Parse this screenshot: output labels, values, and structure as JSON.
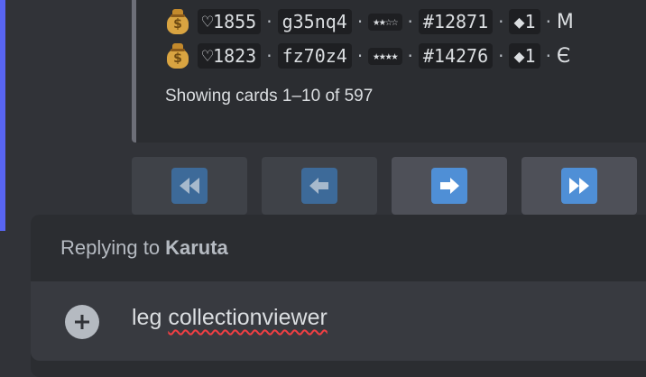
{
  "cards": [
    {
      "icon": "money-bag-icon",
      "wishlist": "♡1855",
      "code": "g35nq4",
      "stars": "★★☆☆",
      "print": "#12871",
      "edition": "◆1",
      "tail": "M"
    },
    {
      "icon": "money-bag-icon",
      "wishlist": "♡1823",
      "code": "fz70z4",
      "stars": "★★★★",
      "print": "#14276",
      "edition": "◆1",
      "tail": "Є"
    }
  ],
  "separator": "·",
  "money_symbol": "$",
  "showing_text": "Showing cards 1–10 of 597",
  "pagination": [
    {
      "name": "first-page-button",
      "icon": "double-left-arrow-icon",
      "enabled": false
    },
    {
      "name": "previous-page-button",
      "icon": "left-arrow-icon",
      "enabled": false
    },
    {
      "name": "next-page-button",
      "icon": "right-arrow-icon",
      "enabled": true
    },
    {
      "name": "last-page-button",
      "icon": "double-right-arrow-icon",
      "enabled": true
    }
  ],
  "reply": {
    "prefix": "Replying to",
    "user": "Karuta"
  },
  "composer": {
    "text_word1": "leg",
    "text_word2": "collectionviewer"
  },
  "colors": {
    "accent": "#5865f2",
    "button_active": "#4f8fd6",
    "button_dim": "#3d6a99",
    "spellcheck": "#f23f43"
  }
}
